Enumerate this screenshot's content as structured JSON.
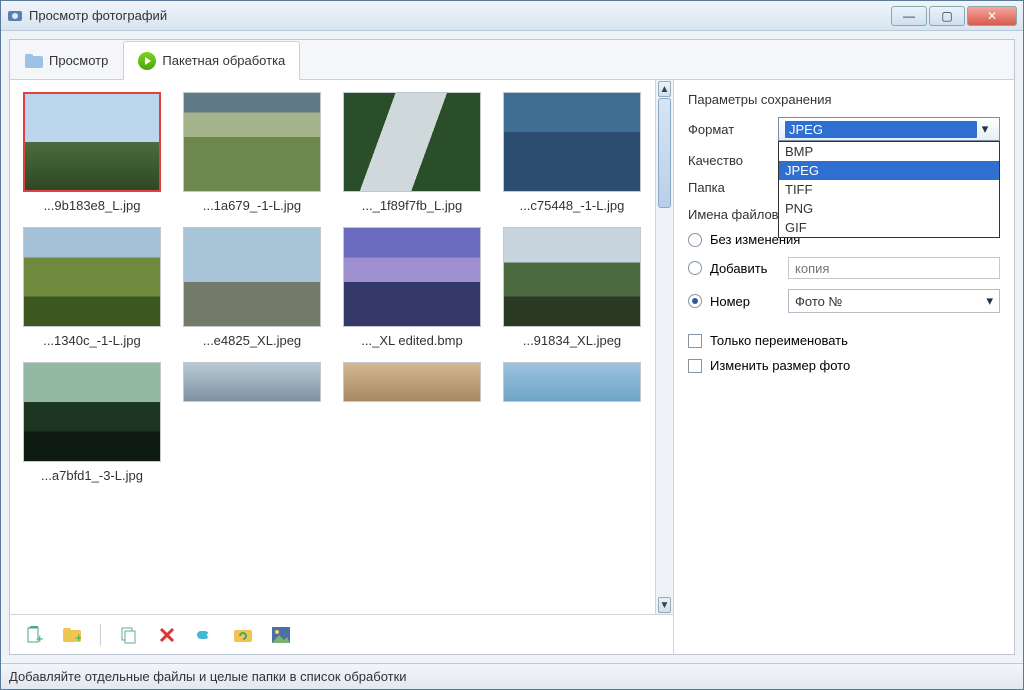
{
  "window": {
    "title": "Просмотр фотографий"
  },
  "tabs": {
    "view": "Просмотр",
    "batch": "Пакетная обработка"
  },
  "thumbs": [
    {
      "name": "...9b183e8_L.jpg",
      "cls": "img1",
      "selected": true
    },
    {
      "name": "...1a679_-1-L.jpg",
      "cls": "img2"
    },
    {
      "name": "..._1f89f7fb_L.jpg",
      "cls": "img3"
    },
    {
      "name": "...c75448_-1-L.jpg",
      "cls": "img4"
    },
    {
      "name": "...1340c_-1-L.jpg",
      "cls": "img5"
    },
    {
      "name": "...e4825_XL.jpeg",
      "cls": "img6"
    },
    {
      "name": "..._XL edited.bmp",
      "cls": "img7"
    },
    {
      "name": "...91834_XL.jpeg",
      "cls": "img8"
    },
    {
      "name": "...a7bfd1_-3-L.jpg",
      "cls": "img9"
    }
  ],
  "panel": {
    "save_title": "Параметры сохранения",
    "format_label": "Формат",
    "format_value": "JPEG",
    "format_options": [
      "BMP",
      "JPEG",
      "TIFF",
      "PNG",
      "GIF"
    ],
    "quality_label": "Качество",
    "folder_label": "Папка",
    "names_title": "Имена файлов",
    "radio_unchanged": "Без изменения",
    "radio_append": "Добавить",
    "append_placeholder": "копия",
    "radio_number": "Номер",
    "number_value": "Фото №",
    "check_rename": "Только переименовать",
    "check_resize": "Изменить размер фото"
  },
  "status": "Добавляйте отдельные файлы и целые папки в список обработки"
}
